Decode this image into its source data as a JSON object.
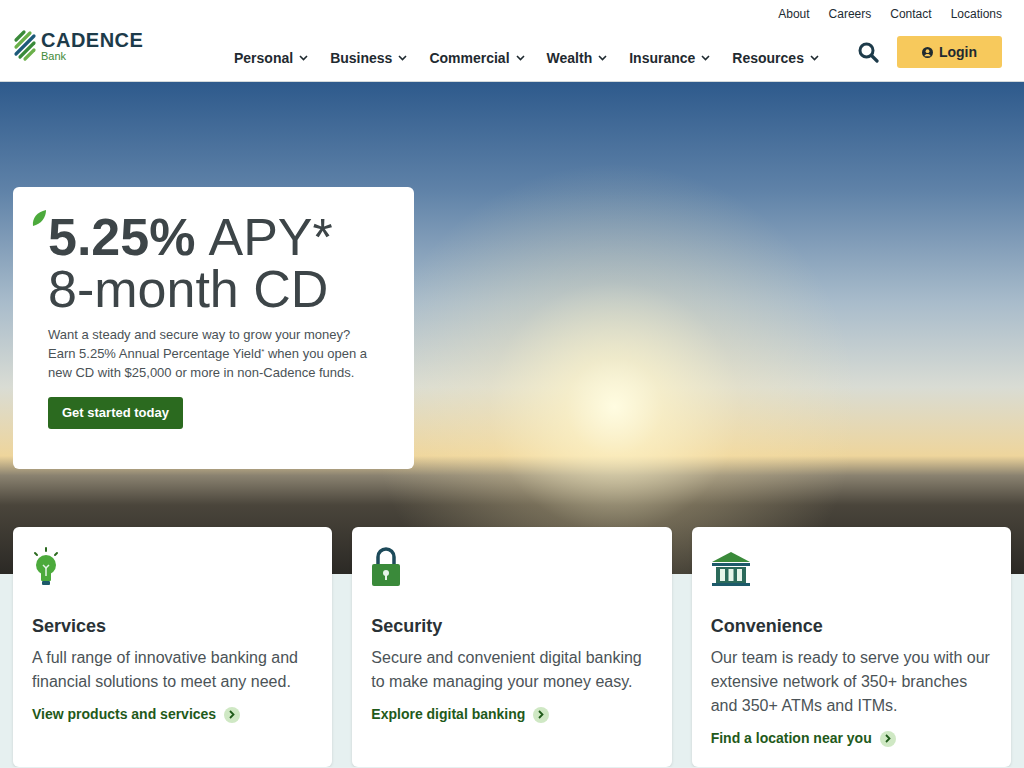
{
  "utility_nav": [
    "About",
    "Careers",
    "Contact",
    "Locations"
  ],
  "logo": {
    "wordmark": "CADENCE",
    "sub": "Bank"
  },
  "main_nav": [
    "Personal",
    "Business",
    "Commercial",
    "Wealth",
    "Insurance",
    "Resources"
  ],
  "login": {
    "label": "Login"
  },
  "hero": {
    "rate": "5.25%",
    "rate_unit": "APY*",
    "term": "8-month CD",
    "text_1": "Want a steady and secure way to grow your money? Earn 5.25% Annual Percentage Yield",
    "text_sup": "*",
    "text_2": " when you open a new CD with $25,000 or more in non-Cadence funds.",
    "button": "Get started today"
  },
  "cards": [
    {
      "title": "Services",
      "text": "A full range of innovative banking and financial solutions to meet any need.",
      "link": "View products and services"
    },
    {
      "title": "Security",
      "text": "Secure and convenient digital banking to make managing your money easy.",
      "link": "Explore digital banking"
    },
    {
      "title": "Convenience",
      "text": "Our team is ready to serve you with our extensive network of 350+ branches and 350+ ATMs and ITMs.",
      "link": "Find a location near you"
    }
  ]
}
